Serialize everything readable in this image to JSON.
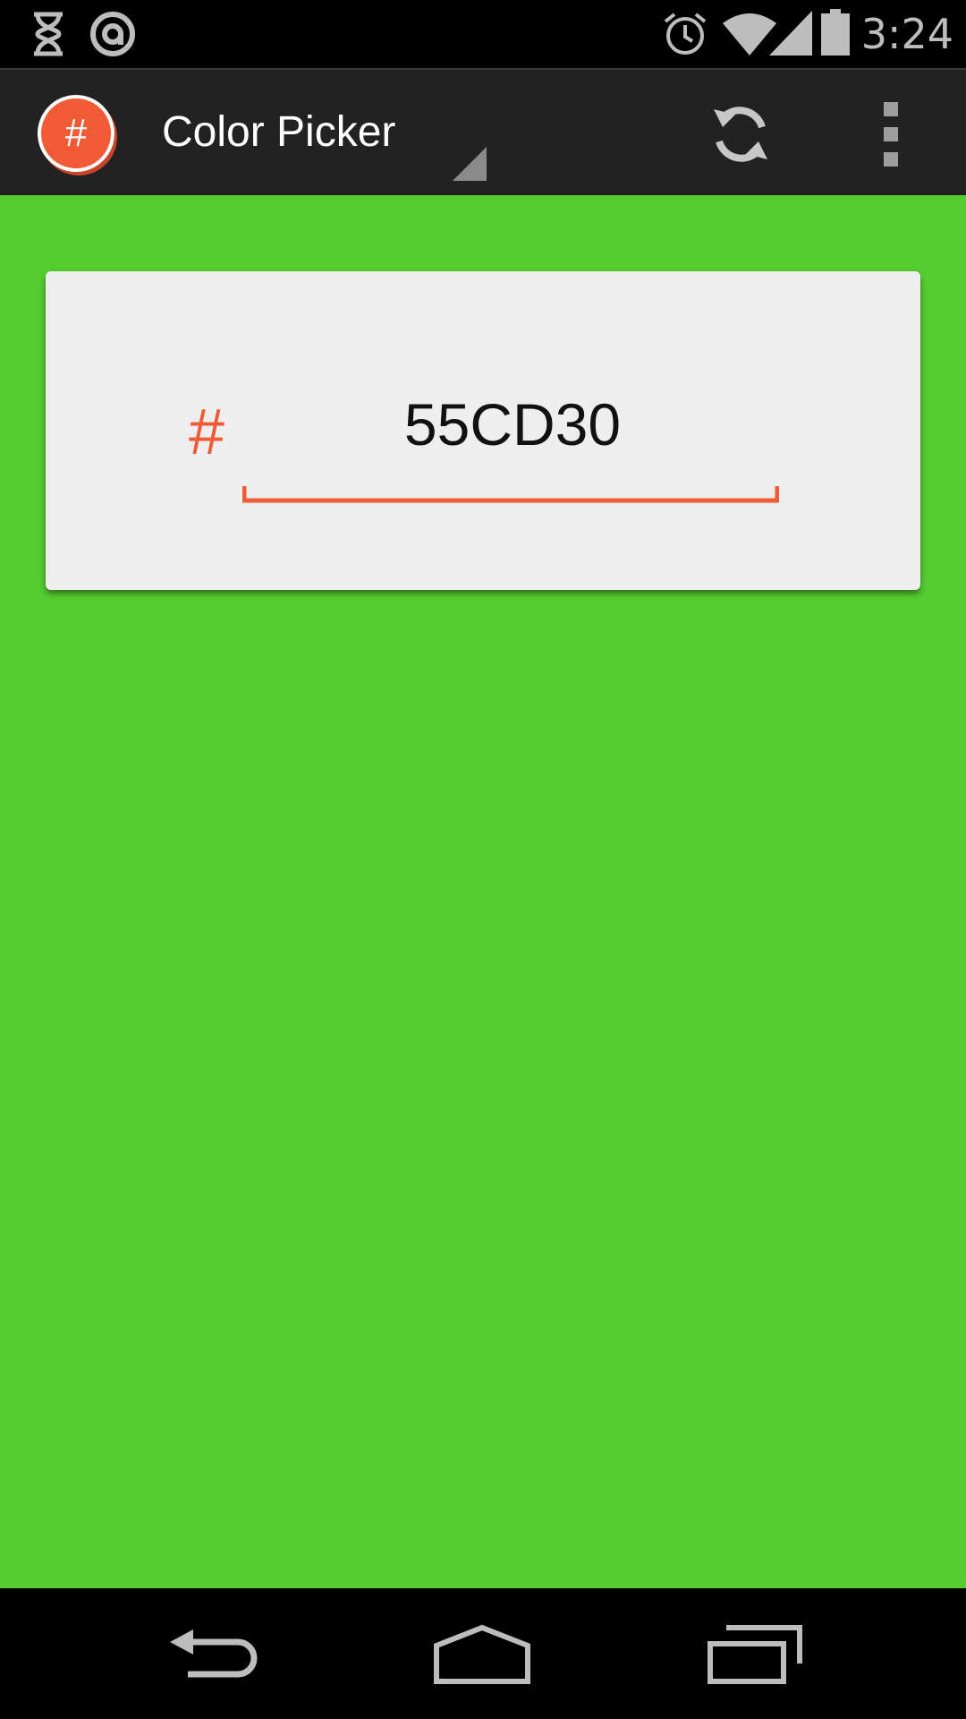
{
  "status_bar": {
    "time": "3:24",
    "icons": [
      "hourglass-icon",
      "swirl-icon",
      "alarm-icon",
      "wifi-icon",
      "signal-icon",
      "battery-icon"
    ]
  },
  "action_bar": {
    "app_icon_glyph": "#",
    "title": "Color Picker",
    "icons": [
      "refresh-icon",
      "overflow-menu-icon"
    ]
  },
  "picker": {
    "hash_label": "#",
    "hex_value": "55CD30"
  },
  "colors": {
    "background": "#55CD30",
    "accent": "#F05A35",
    "action_bar": "#222222",
    "card": "#EEEEEE"
  },
  "nav_bar": {
    "icons": [
      "back-icon",
      "home-icon",
      "recent-apps-icon"
    ]
  }
}
